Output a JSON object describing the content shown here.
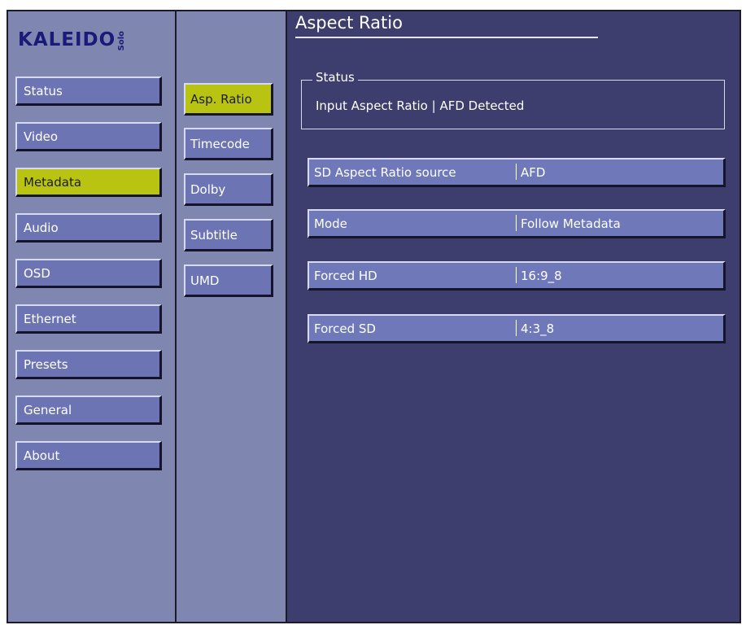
{
  "logo": {
    "text": "KALEIDO",
    "sub": "Solo"
  },
  "nav": {
    "items": [
      {
        "label": "Status"
      },
      {
        "label": "Video"
      },
      {
        "label": "Metadata"
      },
      {
        "label": "Audio"
      },
      {
        "label": "OSD"
      },
      {
        "label": "Ethernet"
      },
      {
        "label": "Presets"
      },
      {
        "label": "General"
      },
      {
        "label": "About"
      }
    ],
    "active": "Metadata"
  },
  "subnav": {
    "items": [
      {
        "label": "Asp. Ratio"
      },
      {
        "label": "Timecode"
      },
      {
        "label": "Dolby"
      },
      {
        "label": "Subtitle"
      },
      {
        "label": "UMD"
      }
    ],
    "active": "Asp. Ratio"
  },
  "page": {
    "title": "Aspect Ratio"
  },
  "status": {
    "legend": "Status",
    "label": "Input Aspect Ratio",
    "value": "AFD Detected"
  },
  "settings": [
    {
      "label": "SD Aspect Ratio source",
      "value": "AFD"
    },
    {
      "label": "Mode",
      "value": "Follow Metadata"
    },
    {
      "label": "Forced HD",
      "value": "16:9_8"
    },
    {
      "label": "Forced SD",
      "value": "4:3_8"
    }
  ],
  "colors": {
    "active_button": "#b9c412",
    "button": "#6c74b3",
    "panel": "#3d3d6e",
    "sidebar": "#7f87b1"
  }
}
